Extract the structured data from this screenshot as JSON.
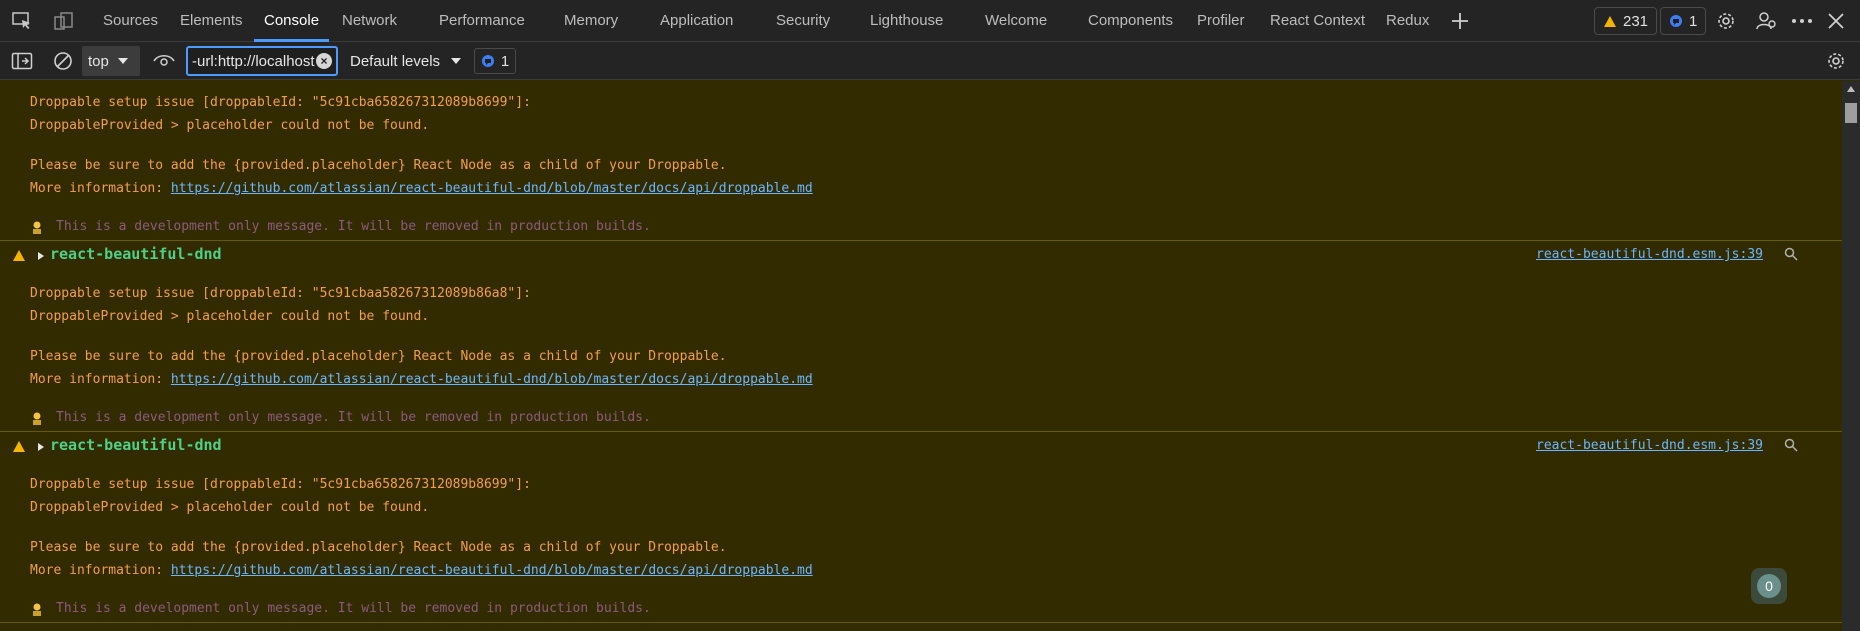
{
  "tabs": [
    {
      "label": "Sources"
    },
    {
      "label": "Elements"
    },
    {
      "label": "Console"
    },
    {
      "label": "Network"
    },
    {
      "label": "Performance"
    },
    {
      "label": "Memory"
    },
    {
      "label": "Application"
    },
    {
      "label": "Security"
    },
    {
      "label": "Lighthouse"
    },
    {
      "label": "Welcome"
    },
    {
      "label": "Components"
    },
    {
      "label": "Profiler"
    },
    {
      "label": "React Context"
    },
    {
      "label": "Redux"
    }
  ],
  "active_tab": "Console",
  "status": {
    "warnings": "231",
    "issues": "1"
  },
  "toolbar": {
    "context": "top",
    "filter_value": "-url:http://localhost",
    "levels_label": "Default levels",
    "issues_count": "1"
  },
  "messages": [
    {
      "group": "",
      "source": "",
      "line1": "Droppable setup issue [droppableId: \"5c91cba658267312089b8699\"]:",
      "line2": "DroppableProvided > placeholder could not be found.",
      "line3": "Please be sure to add the {provided.placeholder} React Node as a child of your Droppable.",
      "line4_prefix": "More information: ",
      "link": "https://github.com/atlassian/react-beautiful-dnd/blob/master/docs/api/droppable.md",
      "dev_note": "This is a development only message. It will be removed in production builds."
    },
    {
      "group": "react-beautiful-dnd",
      "source": "react-beautiful-dnd.esm.js:39",
      "line1": "Droppable setup issue [droppableId: \"5c91cbaa58267312089b86a8\"]:",
      "line2": "DroppableProvided > placeholder could not be found.",
      "line3": "Please be sure to add the {provided.placeholder} React Node as a child of your Droppable.",
      "line4_prefix": "More information: ",
      "link": "https://github.com/atlassian/react-beautiful-dnd/blob/master/docs/api/droppable.md",
      "dev_note": "This is a development only message. It will be removed in production builds."
    },
    {
      "group": "react-beautiful-dnd",
      "source": "react-beautiful-dnd.esm.js:39",
      "line1": "Droppable setup issue [droppableId: \"5c91cba658267312089b8699\"]:",
      "line2": "DroppableProvided > placeholder could not be found.",
      "line3": "Please be sure to add the {provided.placeholder} React Node as a child of your Droppable.",
      "line4_prefix": "More information: ",
      "link": "https://github.com/atlassian/react-beautiful-dnd/blob/master/docs/api/droppable.md",
      "dev_note": "This is a development only message. It will be removed in production builds."
    }
  ],
  "floating_counter": "0",
  "colors": {
    "accent": "#4d9bff",
    "warning_bg": "#332b00",
    "warning_text": "#f29e4c",
    "group_name": "#4cd08a",
    "link": "#6cb6ff"
  }
}
